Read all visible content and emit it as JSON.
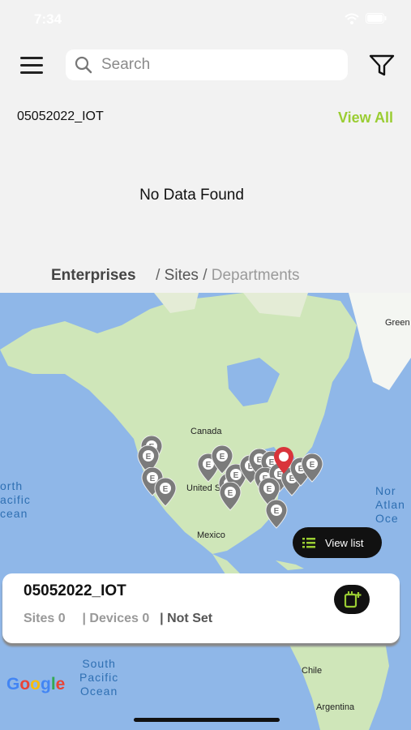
{
  "status": {
    "time": "7:34"
  },
  "search": {
    "placeholder": "Search"
  },
  "enterprise_section": {
    "name": "05052022_IOT",
    "view_all": "View All",
    "empty_message": "No Data Found"
  },
  "breadcrumb": {
    "enterprises": "Enterprises",
    "sep1": "/",
    "sites": "Sites",
    "sep2": "/",
    "departments": "Departments"
  },
  "map": {
    "labels": {
      "greenland": "Green",
      "canada": "Canada",
      "united_states": "United States",
      "mexico": "Mexico",
      "chile": "Chile",
      "argentina": "Argentina"
    },
    "oceans": {
      "north_pacific": "orth\nacific\ncean",
      "north_atlantic": "Nor\nAtlan\nOce",
      "south_pacific": "South\nPacific\nOcean"
    },
    "pin_letter": "E",
    "view_list": "View list",
    "attribution": "Google"
  },
  "card": {
    "title": "05052022_IOT",
    "sites": "Sites 0",
    "devices": "| Devices 0",
    "status": "| Not Set"
  },
  "colors": {
    "accent": "#9acd32",
    "ocean": "#8fb7e8",
    "land": "#cfe6b9",
    "pin_gray": "#7b7b7b",
    "pin_red": "#d9343b"
  }
}
